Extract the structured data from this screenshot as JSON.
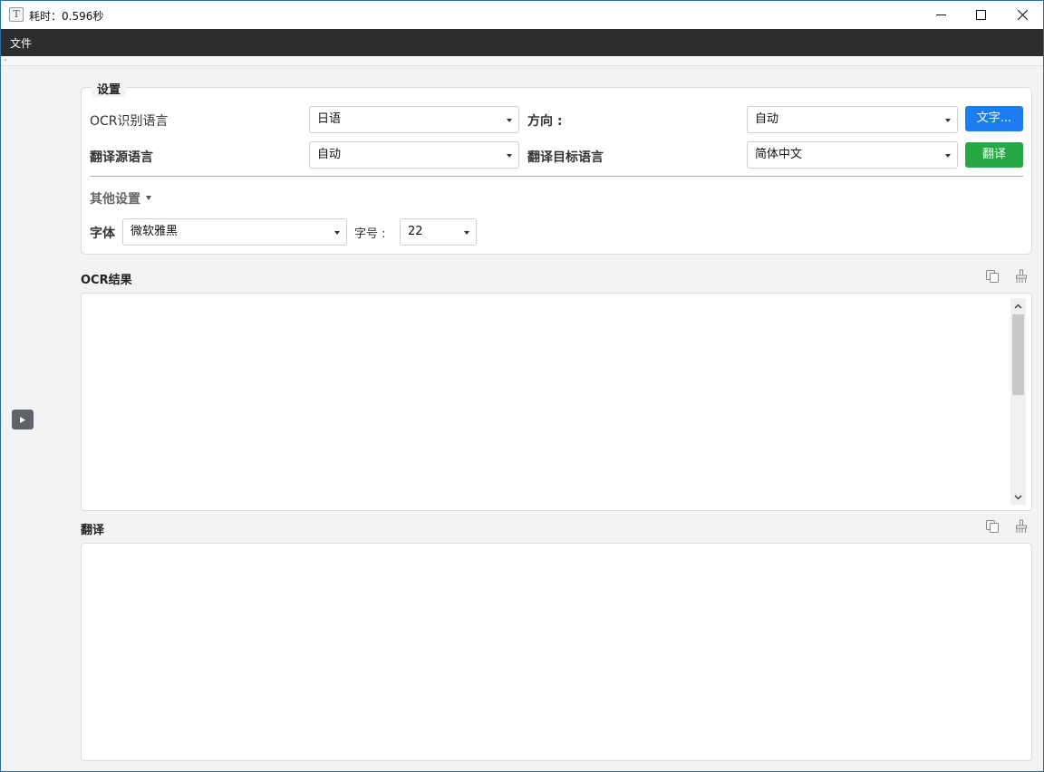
{
  "window": {
    "title": "耗时：0.596秒",
    "app_icon_glyph": "T"
  },
  "menu": {
    "file_label": "文件"
  },
  "settings": {
    "legend": "设置",
    "ocr_language_label": "OCR识别语言",
    "ocr_language_value": "日语",
    "direction_label": "方向 :",
    "direction_value": "自动",
    "text_button_label": "文字...",
    "source_language_label": "翻译源语言",
    "source_language_value": "自动",
    "target_language_label": "翻译目标语言",
    "target_language_value": "简体中文",
    "translate_button_label": "翻译",
    "other_settings_label": "其他设置",
    "font_label": "字体",
    "font_value": "微软雅黑",
    "font_size_label": "字号 :",
    "font_size_value": "22"
  },
  "ocr_result": {
    "title": "OCR结果",
    "text": ""
  },
  "translation": {
    "title": "翻译",
    "text": ""
  },
  "icons": {
    "copy": "copy-icon",
    "clear": "clear-brush-icon"
  },
  "colors": {
    "accent_blue": "#1a7ef2",
    "accent_green": "#28a745",
    "menubar": "#2d2d2d"
  }
}
